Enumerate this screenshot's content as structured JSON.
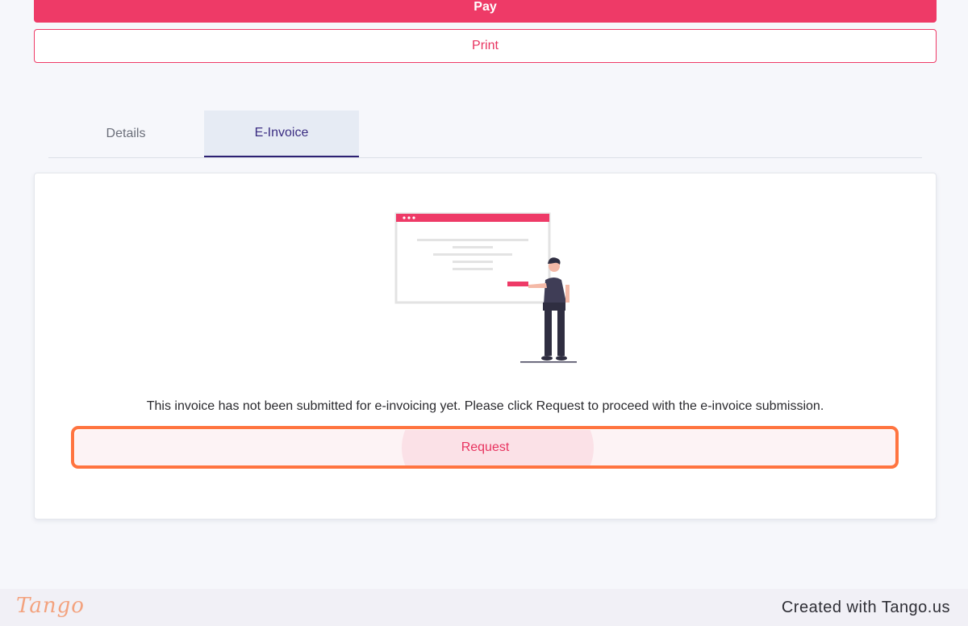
{
  "actions": {
    "pay_label": "Pay",
    "print_label": "Print"
  },
  "tabs": [
    {
      "label": "Details",
      "active": false
    },
    {
      "label": "E-Invoice",
      "active": true
    }
  ],
  "einvoice": {
    "illustration": "person-presenting-browser-window-illustration",
    "message": "This invoice has not been submitted for e-invoicing yet. Please click Request to proceed with the e-invoice submission.",
    "request_label": "Request"
  },
  "footer": {
    "logo": "Tango",
    "caption": "Created with Tango.us"
  },
  "colors": {
    "primary": "#ee3a67",
    "tab_active_bg": "#e6ebf4",
    "tab_active_text": "#3b2d82",
    "highlight": "#ff7440"
  }
}
